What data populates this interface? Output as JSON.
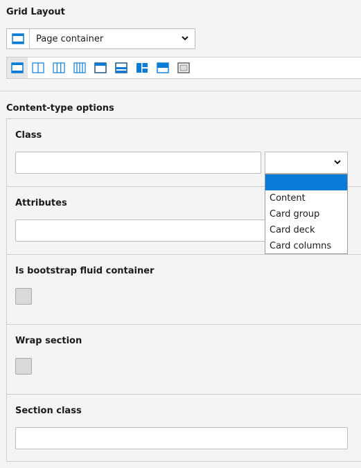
{
  "grid_layout": {
    "heading": "Grid Layout",
    "selected": "Page container",
    "layout_icons": [
      "page-container-icon",
      "two-columns-icon",
      "three-columns-icon",
      "four-columns-icon",
      "header-icon",
      "horizontal-split-icon",
      "tiles-icon",
      "banner-icon",
      "frame-icon"
    ],
    "active_index": 0,
    "accent": "#0a7bd6"
  },
  "content_type": {
    "heading": "Content-type options",
    "class_label": "Class",
    "class_value": "",
    "class_select_value": "",
    "class_options": [
      "",
      "Content",
      "Card group",
      "Card deck",
      "Card columns"
    ],
    "attributes_label": "Attributes",
    "attributes_value": "",
    "fluid_label": "Is bootstrap fluid container",
    "fluid_checked": false,
    "wrap_label": "Wrap section",
    "wrap_checked": false,
    "section_class_label": "Section class",
    "section_class_value": ""
  }
}
